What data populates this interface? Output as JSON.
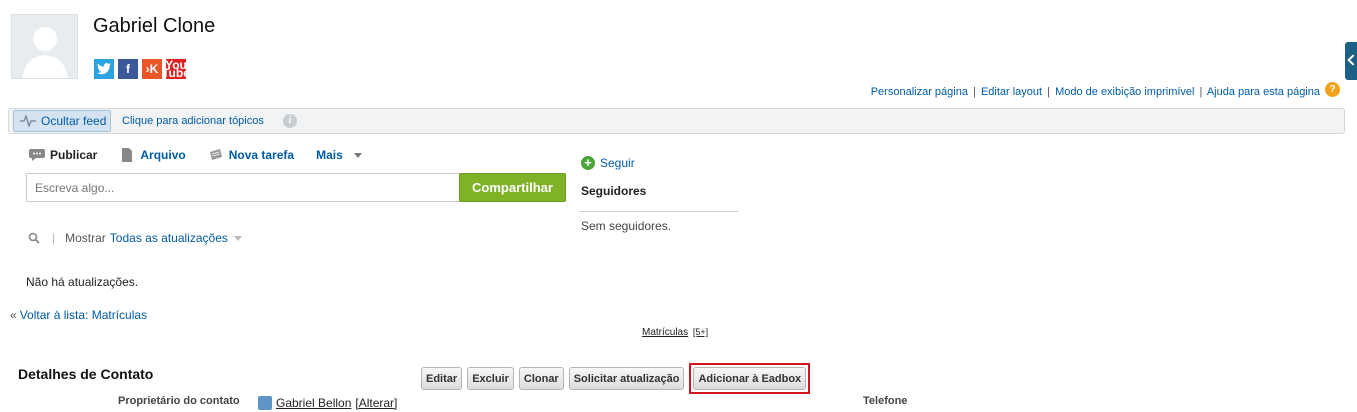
{
  "profile": {
    "name": "Gabriel Clone",
    "social_icons": [
      "twitter-icon",
      "facebook-icon",
      "klout-icon",
      "youtube-icon"
    ]
  },
  "top_links": {
    "customize": "Personalizar página",
    "edit_layout": "Editar layout",
    "printable": "Modo de exibição imprimível",
    "help": "Ajuda para esta página",
    "separator": "|"
  },
  "feed_bar": {
    "hide_feed": "Ocultar feed",
    "add_topics": "Clique para adicionar tópicos"
  },
  "publisher": {
    "tabs": [
      "Publicar",
      "Arquivo",
      "Nova tarefa",
      "Mais"
    ],
    "placeholder": "Escreva algo...",
    "share": "Compartilhar"
  },
  "filter": {
    "show_label": "Mostrar",
    "show_value": "Todas as atualizações"
  },
  "feed": {
    "empty": "Não há atualizações."
  },
  "followers": {
    "follow": "Seguir",
    "title": "Seguidores",
    "empty": "Sem seguidores."
  },
  "nav": {
    "back_quote": "«",
    "back_link": "Voltar à lista: Matrículas"
  },
  "related": {
    "link": "Matrículas",
    "count": "[5+]"
  },
  "details": {
    "title": "Detalhes de Contato",
    "buttons": [
      "Editar",
      "Excluir",
      "Clonar",
      "Solicitar atualização",
      "Adicionar à Eadbox"
    ],
    "owner_label": "Proprietário do contato",
    "owner_name": "Gabriel Bellon",
    "owner_change": "[Alterar]",
    "phone_label": "Telefone"
  },
  "colors": {
    "link": "#015ba7",
    "share_button": "#7fb227",
    "highlight_border": "#d0161e"
  }
}
